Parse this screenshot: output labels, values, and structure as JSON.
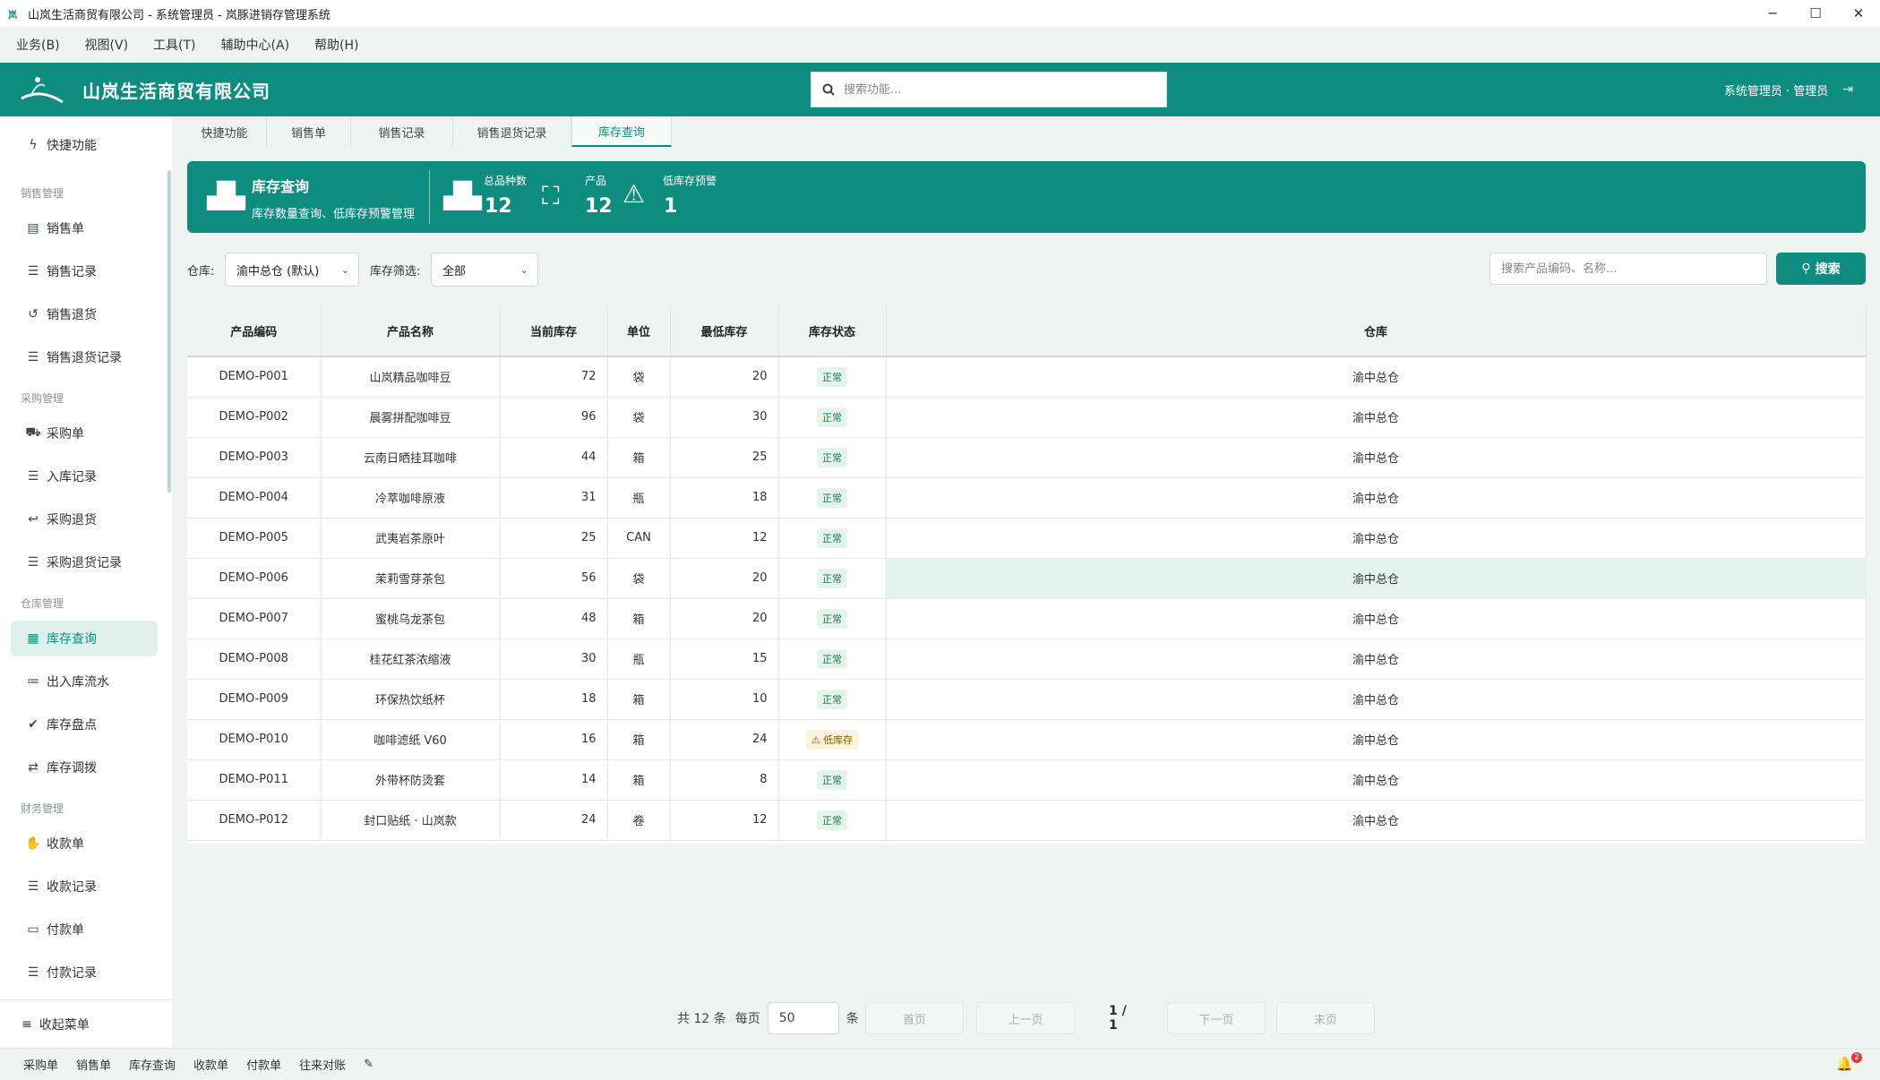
{
  "window": {
    "title": "山岚生活商贸有限公司 - 系统管理员 - 岚豚进销存管理系统",
    "controls": [
      "minimize-icon",
      "maximize-icon",
      "close-icon"
    ]
  },
  "menu": [
    "业务(B)",
    "视图(V)",
    "工具(T)",
    "辅助中心(A)",
    "帮助(H)"
  ],
  "header": {
    "brand": "山岚生活商贸有限公司",
    "search_placeholder": "搜索功能...",
    "user": "系统管理员 · 管理员",
    "accent": "#0e8c80"
  },
  "sidebar": {
    "quick": "快捷功能",
    "groups": {
      "sales": "销售管理",
      "purchase": "采购管理",
      "warehouse": "仓库管理",
      "finance": "财务管理"
    },
    "items": [
      {
        "label": "销售单",
        "icon": "document-icon"
      },
      {
        "label": "销售记录",
        "icon": "list-icon"
      },
      {
        "label": "销售退货",
        "icon": "undo-icon"
      },
      {
        "label": "销售退货记录",
        "icon": "list-icon"
      },
      {
        "label": "采购单",
        "icon": "cart-icon"
      },
      {
        "label": "入库记录",
        "icon": "list-icon"
      },
      {
        "label": "采购退货",
        "icon": "reply-icon"
      },
      {
        "label": "采购退货记录",
        "icon": "list-icon"
      },
      {
        "label": "库存查询",
        "icon": "boxes-icon"
      },
      {
        "label": "出入库流水",
        "icon": "list-ul-icon"
      },
      {
        "label": "库存盘点",
        "icon": "clipboard-check-icon"
      },
      {
        "label": "库存调拨",
        "icon": "transfer-icon"
      },
      {
        "label": "收款单",
        "icon": "hand-coin-icon"
      },
      {
        "label": "收款记录",
        "icon": "list-icon"
      },
      {
        "label": "付款单",
        "icon": "money-icon"
      },
      {
        "label": "付款记录",
        "icon": "list-icon"
      }
    ],
    "collapse": "收起菜单"
  },
  "tabs": [
    "快捷功能",
    "销售单",
    "销售记录",
    "销售退货记录",
    "库存查询"
  ],
  "banner": {
    "title": "库存查询",
    "subtitle": "库存数量查询、低库存预警管理",
    "stats": [
      {
        "label": "总品种数",
        "value": "12",
        "icon": "boxes-icon"
      },
      {
        "label": "产品",
        "value": "12",
        "icon": "sofa-icon"
      },
      {
        "label": "低库存预警",
        "value": "1",
        "icon": "warning-icon"
      }
    ]
  },
  "filters": {
    "warehouse_label": "仓库:",
    "warehouse_value": "渝中总仓 (默认)",
    "stock_label": "库存筛选:",
    "stock_value": "全部",
    "search_placeholder": "搜索产品编码、名称...",
    "search_button": "搜索"
  },
  "table": {
    "columns": [
      "产品编码",
      "产品名称",
      "当前库存",
      "单位",
      "最低库存",
      "库存状态",
      "仓库"
    ],
    "rows": [
      [
        "DEMO-P001",
        "山岚精品咖啡豆",
        "72",
        "袋",
        "20",
        "正常",
        "渝中总仓"
      ],
      [
        "DEMO-P002",
        "晨雾拼配咖啡豆",
        "96",
        "袋",
        "30",
        "正常",
        "渝中总仓"
      ],
      [
        "DEMO-P003",
        "云南日晒挂耳咖啡",
        "44",
        "箱",
        "25",
        "正常",
        "渝中总仓"
      ],
      [
        "DEMO-P004",
        "冷萃咖啡原液",
        "31",
        "瓶",
        "18",
        "正常",
        "渝中总仓"
      ],
      [
        "DEMO-P005",
        "武夷岩茶原叶",
        "25",
        "CAN",
        "12",
        "正常",
        "渝中总仓"
      ],
      [
        "DEMO-P006",
        "茉莉雪芽茶包",
        "56",
        "袋",
        "20",
        "正常",
        "渝中总仓"
      ],
      [
        "DEMO-P007",
        "蜜桃乌龙茶包",
        "48",
        "箱",
        "20",
        "正常",
        "渝中总仓"
      ],
      [
        "DEMO-P008",
        "桂花红茶浓缩液",
        "30",
        "瓶",
        "15",
        "正常",
        "渝中总仓"
      ],
      [
        "DEMO-P009",
        "环保热饮纸杯",
        "18",
        "箱",
        "10",
        "正常",
        "渝中总仓"
      ],
      [
        "DEMO-P010",
        "咖啡滤纸 V60",
        "16",
        "箱",
        "24",
        "低库存",
        "渝中总仓"
      ],
      [
        "DEMO-P011",
        "外带杯防烫套",
        "14",
        "箱",
        "8",
        "正常",
        "渝中总仓"
      ],
      [
        "DEMO-P012",
        "封口贴纸 · 山岚款",
        "24",
        "卷",
        "12",
        "正常",
        "渝中总仓"
      ]
    ],
    "highlight_row": 5
  },
  "pager": {
    "total": "共 12 条",
    "per_page_label": "每页",
    "per_page": "50",
    "unit": "条",
    "first": "首页",
    "prev": "上一页",
    "page": "1 / 1",
    "next": "下一页",
    "last": "末页"
  },
  "statusbar": {
    "shortcuts": [
      "采购单",
      "销售单",
      "库存查询",
      "收款单",
      "付款单",
      "往来对账"
    ],
    "notifications": "2"
  }
}
